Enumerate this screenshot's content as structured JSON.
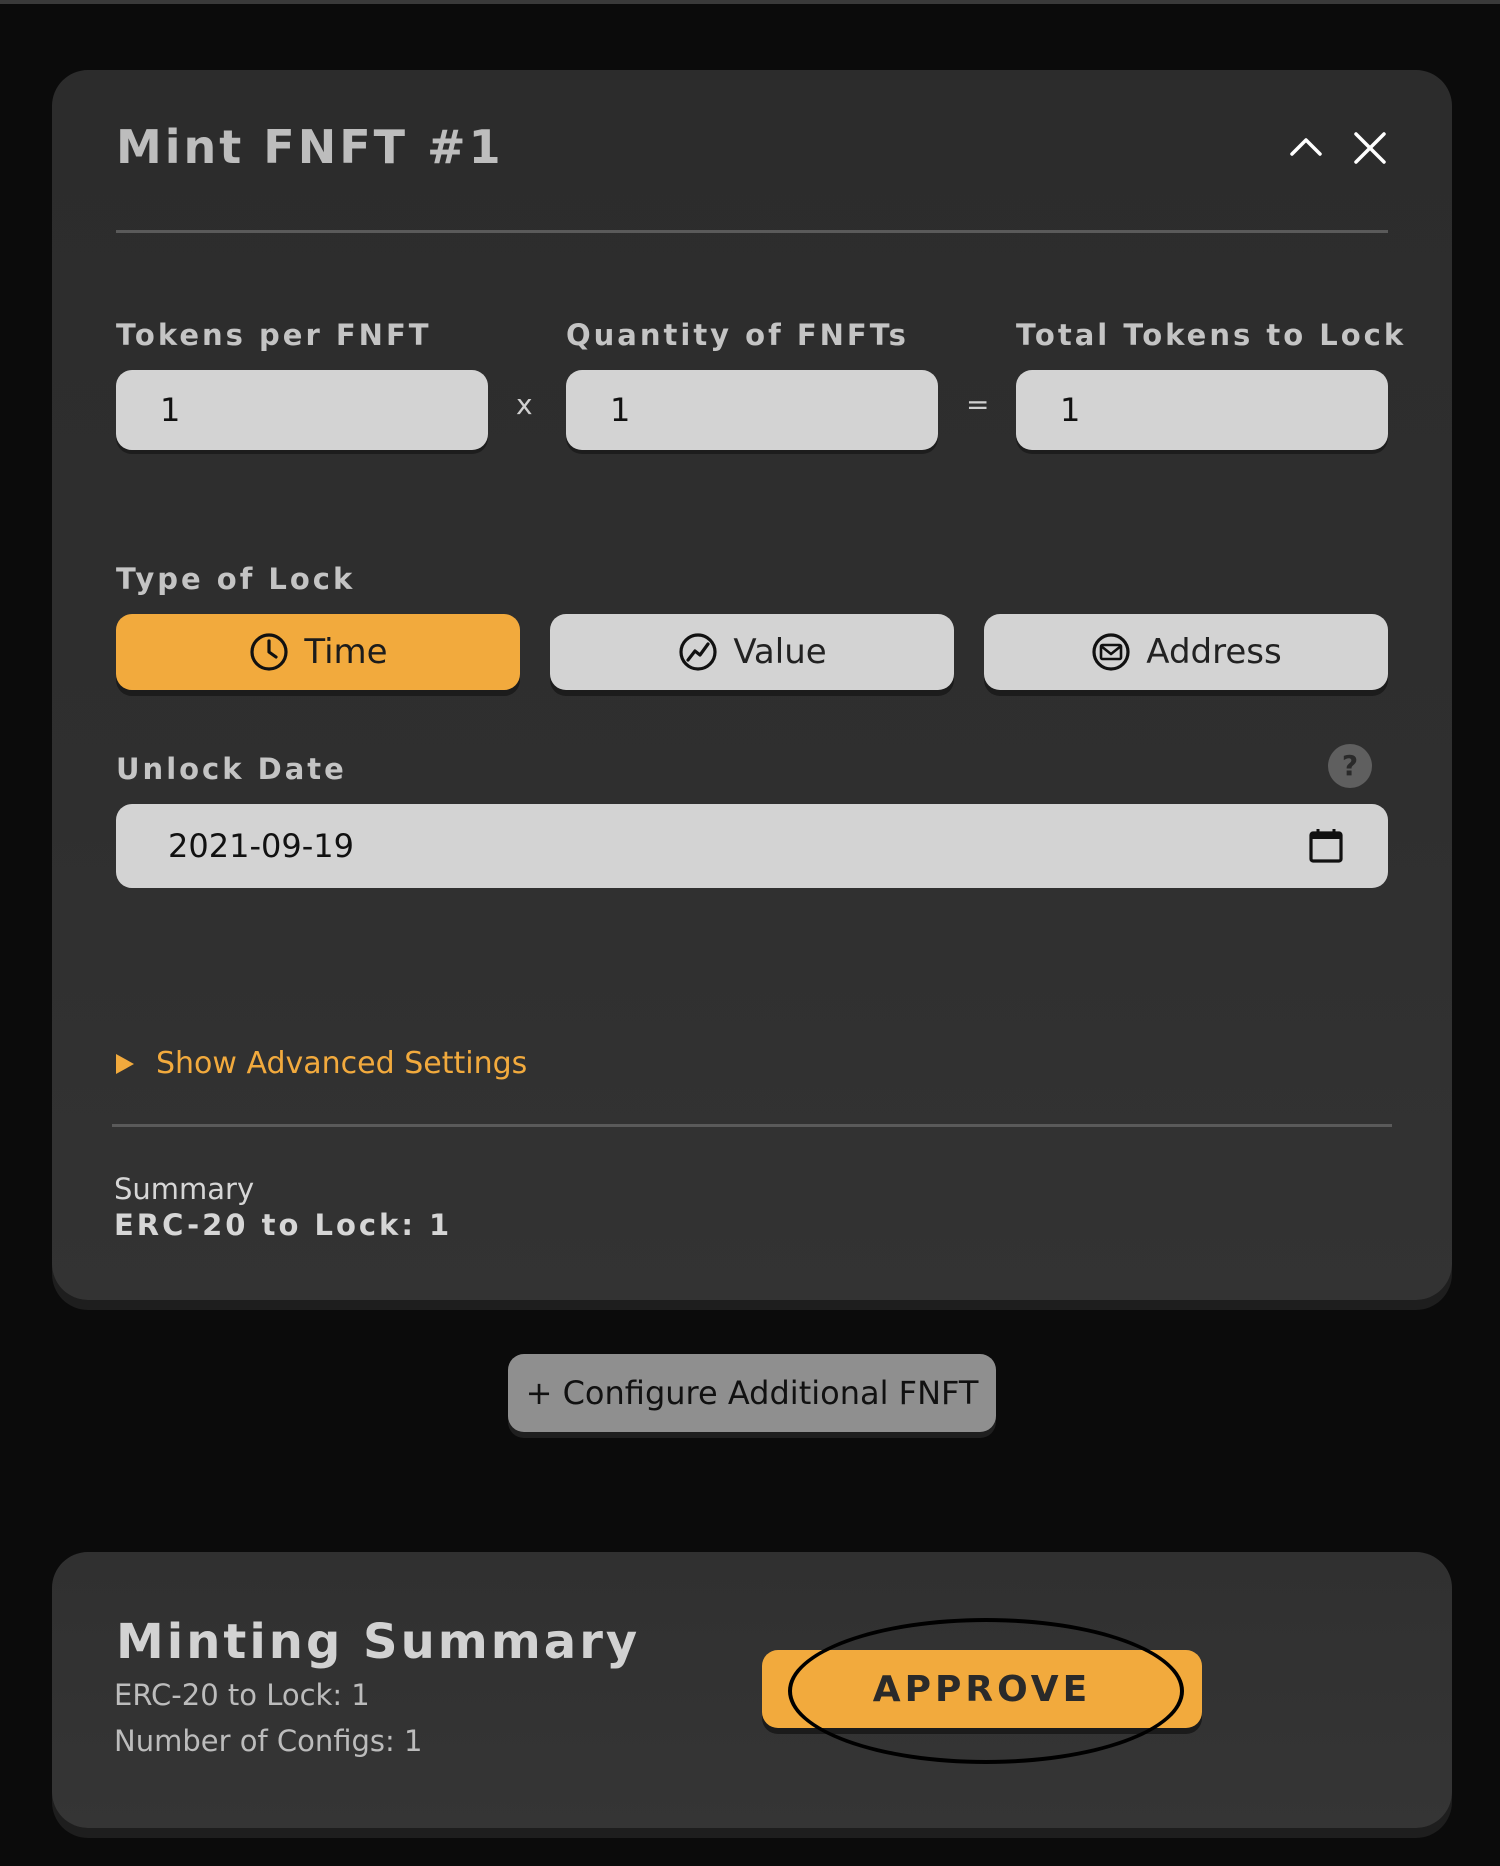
{
  "card": {
    "title": "Mint FNFT #1",
    "fields": {
      "tokens_per_fnft": {
        "label": "Tokens per FNFT",
        "value": "1"
      },
      "quantity_of_fnfts": {
        "label": "Quantity of FNFTs",
        "value": "1"
      },
      "total_tokens": {
        "label": "Total Tokens to Lock",
        "value": "1"
      },
      "multiply_symbol": "x",
      "equals_symbol": "="
    },
    "lock_type": {
      "label": "Type of Lock",
      "options": [
        {
          "label": "Time",
          "icon": "clock-icon",
          "selected": true
        },
        {
          "label": "Value",
          "icon": "chart-icon",
          "selected": false
        },
        {
          "label": "Address",
          "icon": "envelope-icon",
          "selected": false
        }
      ]
    },
    "unlock_date": {
      "label": "Unlock Date",
      "value": "2021-09-19",
      "help": "?"
    },
    "advanced_settings": "Show Advanced Settings",
    "summary": {
      "label": "Summary",
      "value": "ERC-20 to Lock: 1"
    }
  },
  "configure_button": "+ Configure Additional FNFT",
  "minting_summary": {
    "title": "Minting Summary",
    "erc20_line": "ERC-20 to Lock: 1",
    "configs_line": "Number of Configs: 1",
    "approve_label": "APPROVE"
  },
  "colors": {
    "accent": "#f2aa3d",
    "input_bg": "#d3d3d3",
    "card_bg": "#2e2e2e",
    "page_bg": "#0b0b0b"
  }
}
